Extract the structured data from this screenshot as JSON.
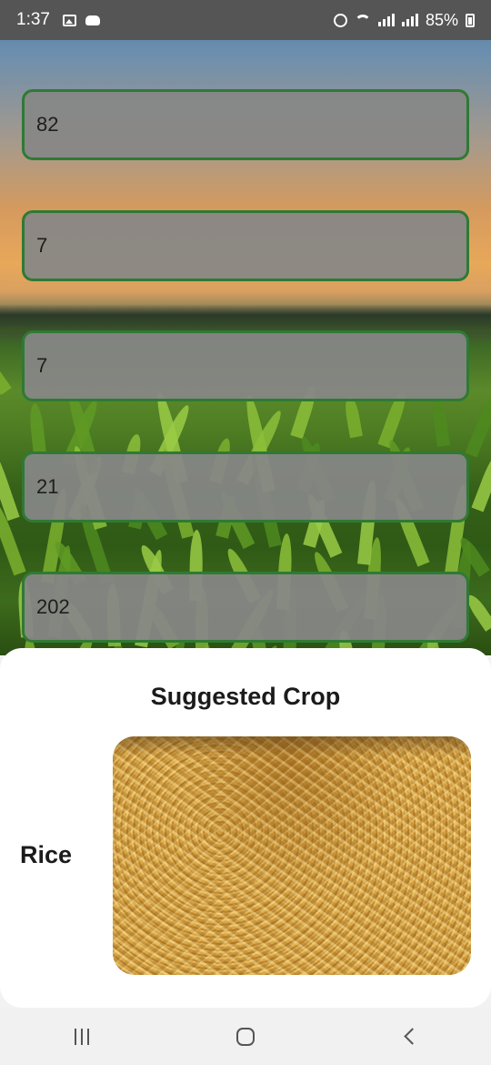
{
  "status_bar": {
    "time": "1:37",
    "battery": "85%",
    "icons_left": [
      "image-icon",
      "game-controller-icon"
    ],
    "icons_right": [
      "alarm-icon",
      "wifi-icon",
      "signal-icon",
      "signal-r-icon",
      "battery-icon"
    ]
  },
  "form": {
    "fields": [
      {
        "value": "82"
      },
      {
        "value": "7"
      },
      {
        "value": "7"
      },
      {
        "value": "21"
      },
      {
        "value": "202"
      }
    ]
  },
  "result": {
    "title": "Suggested Crop",
    "crop_name": "Rice",
    "image_subject": "rice-grains"
  },
  "colors": {
    "field_border": "#2f7a34",
    "field_fill": "#878787",
    "sheet_background": "#ffffff"
  },
  "nav_bar": {
    "buttons": [
      "recents",
      "home",
      "back"
    ]
  }
}
